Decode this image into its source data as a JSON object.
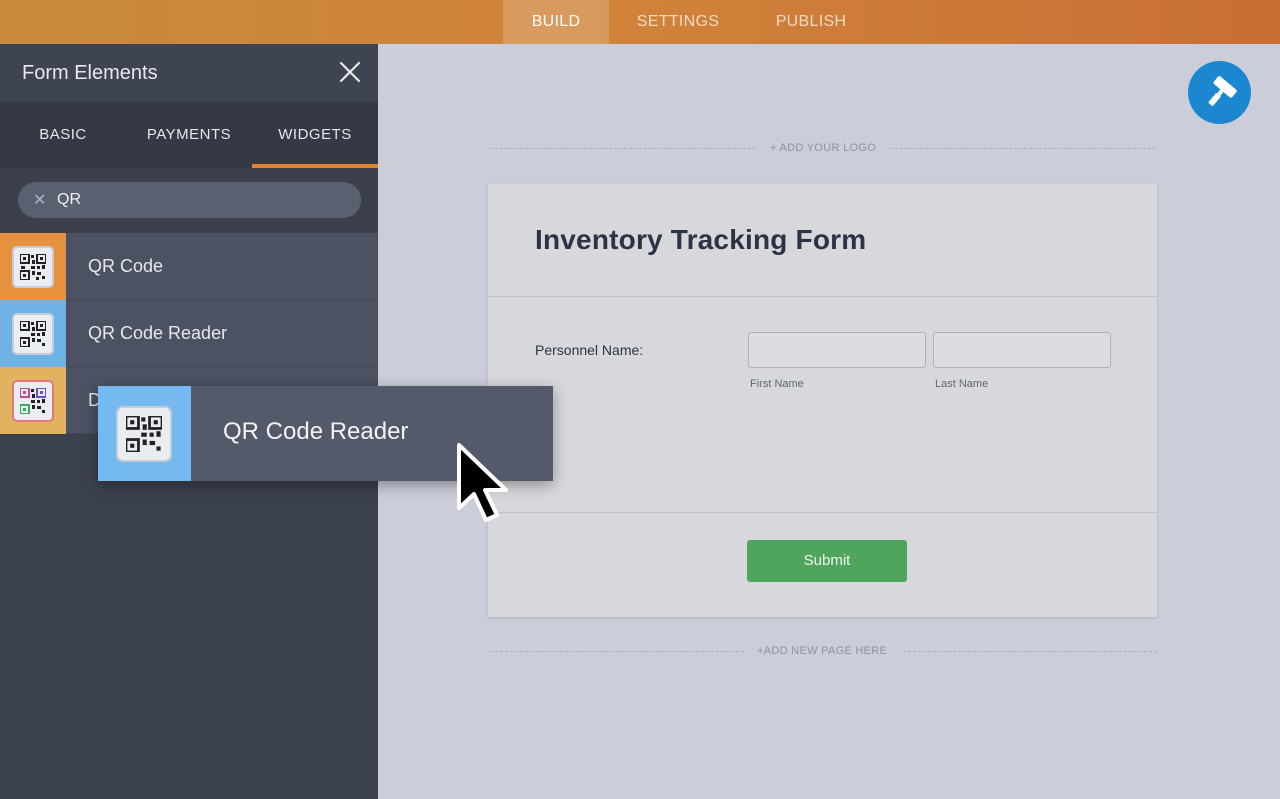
{
  "topnav": {
    "tabs": [
      {
        "label": "BUILD",
        "active": true
      },
      {
        "label": "SETTINGS",
        "active": false
      },
      {
        "label": "PUBLISH",
        "active": false
      }
    ]
  },
  "sidebar": {
    "title": "Form Elements",
    "tabs": [
      {
        "label": "BASIC",
        "active": false
      },
      {
        "label": "PAYMENTS",
        "active": false
      },
      {
        "label": "WIDGETS",
        "active": true
      }
    ],
    "search": {
      "value": "QR"
    },
    "items": [
      {
        "label": "QR Code",
        "icon": "qr-code-icon",
        "tile_color": "#e6913d"
      },
      {
        "label": "QR Code Reader",
        "icon": "qr-code-reader-icon",
        "tile_color": "#6fb2e6"
      },
      {
        "label": "D",
        "icon": "qr-code-colored-icon",
        "tile_color": "#e3b25f"
      }
    ]
  },
  "dragging": {
    "label": "QR Code Reader",
    "icon": "qr-code-reader-icon"
  },
  "canvas": {
    "add_logo": "+ ADD YOUR LOGO",
    "add_page": "+ADD NEW PAGE HERE",
    "form": {
      "title": "Inventory Tracking Form",
      "field_label": "Personnel Name:",
      "first_name_value": "",
      "last_name_value": "",
      "first_sublabel": "First Name",
      "last_sublabel": "Last Name",
      "submit_label": "Submit"
    }
  },
  "colors": {
    "accent_orange": "#e0822f",
    "paint_button": "#1a87d0",
    "submit_green": "#4ea55b"
  }
}
